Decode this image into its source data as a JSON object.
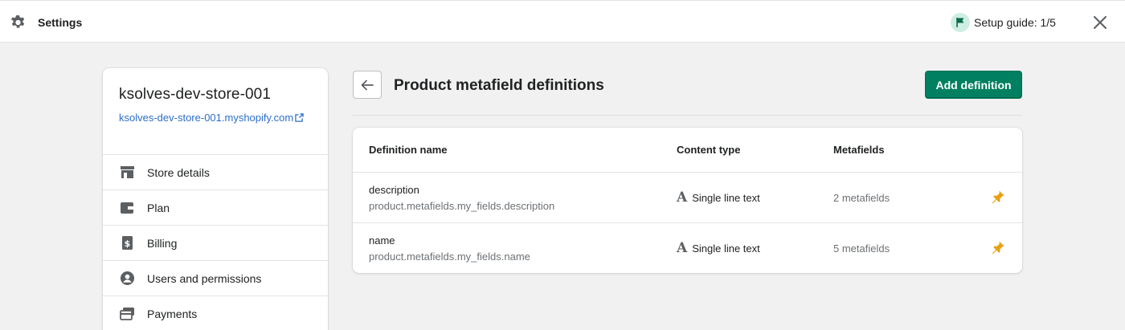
{
  "topbar": {
    "title": "Settings",
    "setup_guide": "Setup guide: 1/5",
    "accent": "#008060"
  },
  "store": {
    "name": "ksolves-dev-store-001",
    "url": "ksolves-dev-store-001.myshopify.com"
  },
  "sidebar": {
    "items": [
      {
        "label": "Store details",
        "icon": "store-icon"
      },
      {
        "label": "Plan",
        "icon": "plan-icon"
      },
      {
        "label": "Billing",
        "icon": "billing-icon"
      },
      {
        "label": "Users and permissions",
        "icon": "user-icon"
      },
      {
        "label": "Payments",
        "icon": "payments-icon"
      }
    ]
  },
  "page": {
    "title": "Product metafield definitions",
    "add_button": "Add definition"
  },
  "table": {
    "columns": [
      "Definition name",
      "Content type",
      "Metafields"
    ],
    "rows": [
      {
        "name": "description",
        "key": "product.metafields.my_fields.description",
        "type": "Single line text",
        "count": "2 metafields",
        "pinned": true
      },
      {
        "name": "name",
        "key": "product.metafields.my_fields.name",
        "type": "Single line text",
        "count": "5 metafields",
        "pinned": true
      }
    ]
  },
  "colors": {
    "primary_button": "#008060",
    "link": "#2c6ecb",
    "pin": "#e8a113"
  }
}
